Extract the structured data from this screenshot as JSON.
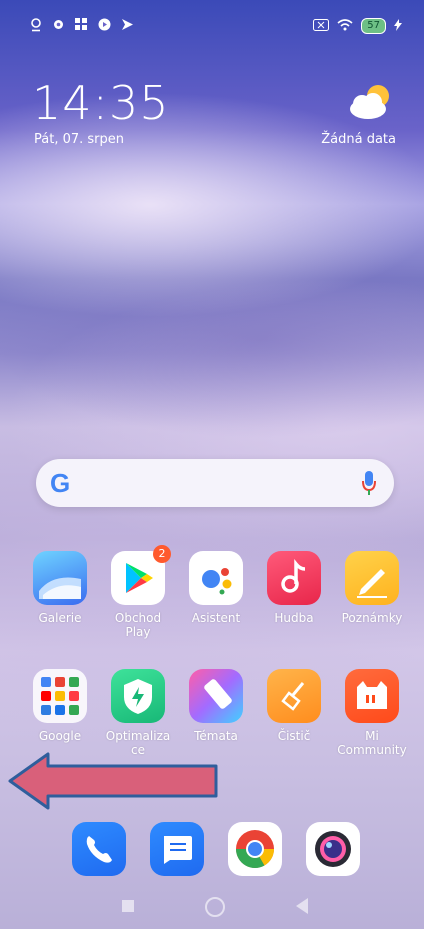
{
  "status": {
    "battery": "57"
  },
  "clock": {
    "time": "14:35",
    "date": "Pát, 07. srpen"
  },
  "weather": {
    "text": "Žádná data"
  },
  "search": {
    "logo": "G"
  },
  "apps_row1": [
    {
      "label": "Galerie"
    },
    {
      "label": "Obchod Play",
      "badge": "2"
    },
    {
      "label": "Asistent"
    },
    {
      "label": "Hudba"
    },
    {
      "label": "Poznámky"
    }
  ],
  "apps_row2": [
    {
      "label": "Google"
    },
    {
      "label": "Optimalizace"
    },
    {
      "label": "Témata"
    },
    {
      "label": "Čistič"
    },
    {
      "label": "Mi Community"
    }
  ],
  "dock": [
    {
      "icon": "phone-icon"
    },
    {
      "icon": "messages-icon"
    },
    {
      "icon": "chrome-icon"
    },
    {
      "icon": "camera-icon"
    }
  ],
  "colors": {
    "arrow_fill": "#d9607a",
    "arrow_stroke": "#2f5e9c"
  }
}
